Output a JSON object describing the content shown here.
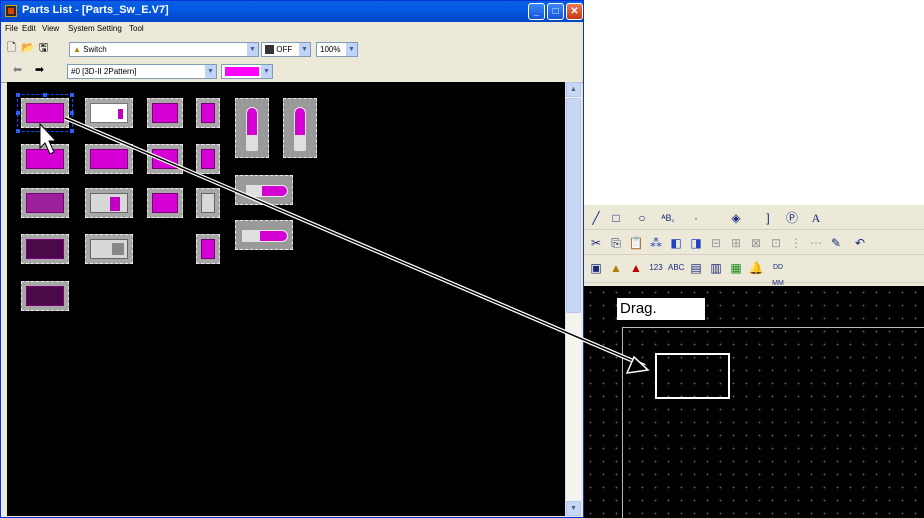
{
  "window": {
    "title": "Parts List - [Parts_Sw_E.V7]",
    "buttons": [
      "minimize",
      "maximize",
      "close"
    ]
  },
  "menubar": {
    "items": [
      "File",
      "Edit",
      "View",
      "System Setting",
      "Tool"
    ]
  },
  "toolbar1": {
    "part_type": "Switch",
    "state": "OFF",
    "zoom": "100%"
  },
  "toolbar2": {
    "pattern": "#0 [3D-II 2Pattern]",
    "color": "#ff00ff"
  },
  "editor": {
    "drag_label": "Drag.",
    "text_tool": "A"
  },
  "colors": {
    "accent_magenta": "#d400d4",
    "canvas": "#000000",
    "titlebar": "#0558e3"
  },
  "icons": {
    "new": "new-file-icon",
    "open": "open-folder-icon",
    "save": "save-icon",
    "back": "arrow-left-icon",
    "forward": "arrow-right-icon"
  }
}
